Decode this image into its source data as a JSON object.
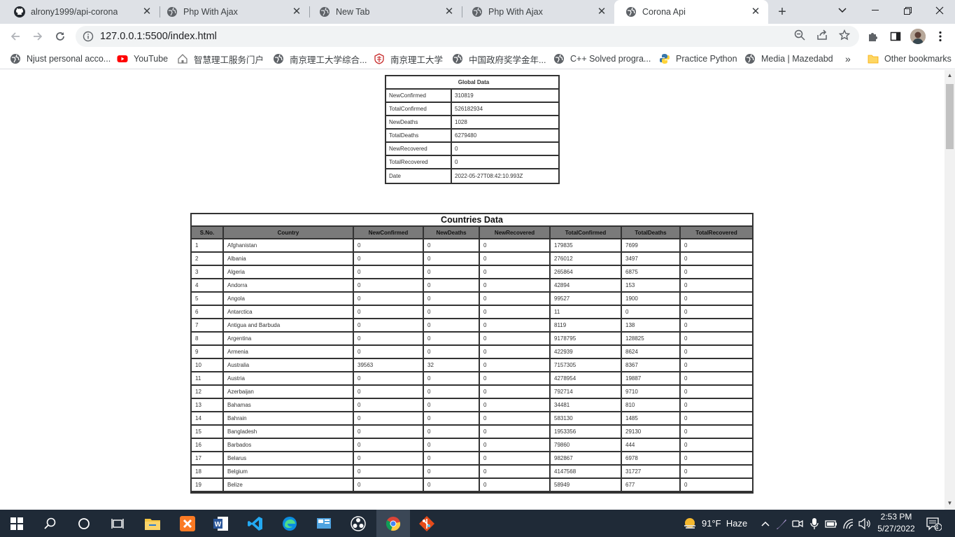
{
  "tabs": [
    {
      "title": "alrony1999/api-corona",
      "icon": "github-icon"
    },
    {
      "title": "Php With Ajax",
      "icon": "globe-icon"
    },
    {
      "title": "New Tab",
      "icon": "globe-icon"
    },
    {
      "title": "Php With Ajax",
      "icon": "globe-icon"
    },
    {
      "title": "Corona Api",
      "icon": "globe-icon",
      "active": true
    }
  ],
  "address_bar": {
    "url": "127.0.0.1:5500/index.html"
  },
  "bookmarks": [
    {
      "label": "Njust personal acco...",
      "icon": "globe-icon"
    },
    {
      "label": "YouTube",
      "icon": "youtube-icon"
    },
    {
      "label": "智慧理工服务门户",
      "icon": "home-icon"
    },
    {
      "label": "南京理工大学综合...",
      "icon": "globe-icon"
    },
    {
      "label": "南京理工大学",
      "icon": "university-icon"
    },
    {
      "label": "中国政府奖学金年...",
      "icon": "globe-icon"
    },
    {
      "label": "C++ Solved progra...",
      "icon": "globe-icon"
    },
    {
      "label": "Practice Python",
      "icon": "python-icon"
    },
    {
      "label": "Media | Mazedabd",
      "icon": "globe-icon"
    }
  ],
  "bookmarks_more": "»",
  "other_bookmarks": "Other bookmarks",
  "global": {
    "title": "Global Data",
    "rows": [
      {
        "key": "NewConfirmed",
        "value": "310819"
      },
      {
        "key": "TotalConfirmed",
        "value": "526182934"
      },
      {
        "key": "NewDeaths",
        "value": "1028"
      },
      {
        "key": "TotalDeaths",
        "value": "6279480"
      },
      {
        "key": "NewRecovered",
        "value": "0"
      },
      {
        "key": "TotalRecovered",
        "value": "0"
      },
      {
        "key": "Date",
        "value": "2022-05-27T08:42:10.993Z"
      }
    ]
  },
  "countries": {
    "title": "Countries Data",
    "columns": [
      "S.No.",
      "Country",
      "NewConfirmed",
      "NewDeaths",
      "NewRecovered",
      "TotalConfirmed",
      "TotalDeaths",
      "TotalRecovered"
    ],
    "rows": [
      [
        "1",
        "Afghanistan",
        "0",
        "0",
        "0",
        "179835",
        "7699",
        "0"
      ],
      [
        "2",
        "Albania",
        "0",
        "0",
        "0",
        "276012",
        "3497",
        "0"
      ],
      [
        "3",
        "Algeria",
        "0",
        "0",
        "0",
        "265864",
        "6875",
        "0"
      ],
      [
        "4",
        "Andorra",
        "0",
        "0",
        "0",
        "42894",
        "153",
        "0"
      ],
      [
        "5",
        "Angola",
        "0",
        "0",
        "0",
        "99527",
        "1900",
        "0"
      ],
      [
        "6",
        "Antarctica",
        "0",
        "0",
        "0",
        "11",
        "0",
        "0"
      ],
      [
        "7",
        "Antigua and Barbuda",
        "0",
        "0",
        "0",
        "8119",
        "138",
        "0"
      ],
      [
        "8",
        "Argentina",
        "0",
        "0",
        "0",
        "9178795",
        "128825",
        "0"
      ],
      [
        "9",
        "Armenia",
        "0",
        "0",
        "0",
        "422939",
        "8624",
        "0"
      ],
      [
        "10",
        "Australia",
        "39563",
        "32",
        "0",
        "7157305",
        "8367",
        "0"
      ],
      [
        "11",
        "Austria",
        "0",
        "0",
        "0",
        "4278954",
        "19887",
        "0"
      ],
      [
        "12",
        "Azerbaijan",
        "0",
        "0",
        "0",
        "792714",
        "9710",
        "0"
      ],
      [
        "13",
        "Bahamas",
        "0",
        "0",
        "0",
        "34481",
        "810",
        "0"
      ],
      [
        "14",
        "Bahrain",
        "0",
        "0",
        "0",
        "583130",
        "1485",
        "0"
      ],
      [
        "15",
        "Bangladesh",
        "0",
        "0",
        "0",
        "1953356",
        "29130",
        "0"
      ],
      [
        "16",
        "Barbados",
        "0",
        "0",
        "0",
        "79860",
        "444",
        "0"
      ],
      [
        "17",
        "Belarus",
        "0",
        "0",
        "0",
        "982867",
        "6978",
        "0"
      ],
      [
        "18",
        "Belgium",
        "0",
        "0",
        "0",
        "4147568",
        "31727",
        "0"
      ],
      [
        "19",
        "Belize",
        "0",
        "0",
        "0",
        "58949",
        "677",
        "0"
      ]
    ]
  },
  "taskbar": {
    "weather": "91°F  Haze",
    "time": "2:53 PM",
    "date": "5/27/2022",
    "notifications": "4"
  }
}
